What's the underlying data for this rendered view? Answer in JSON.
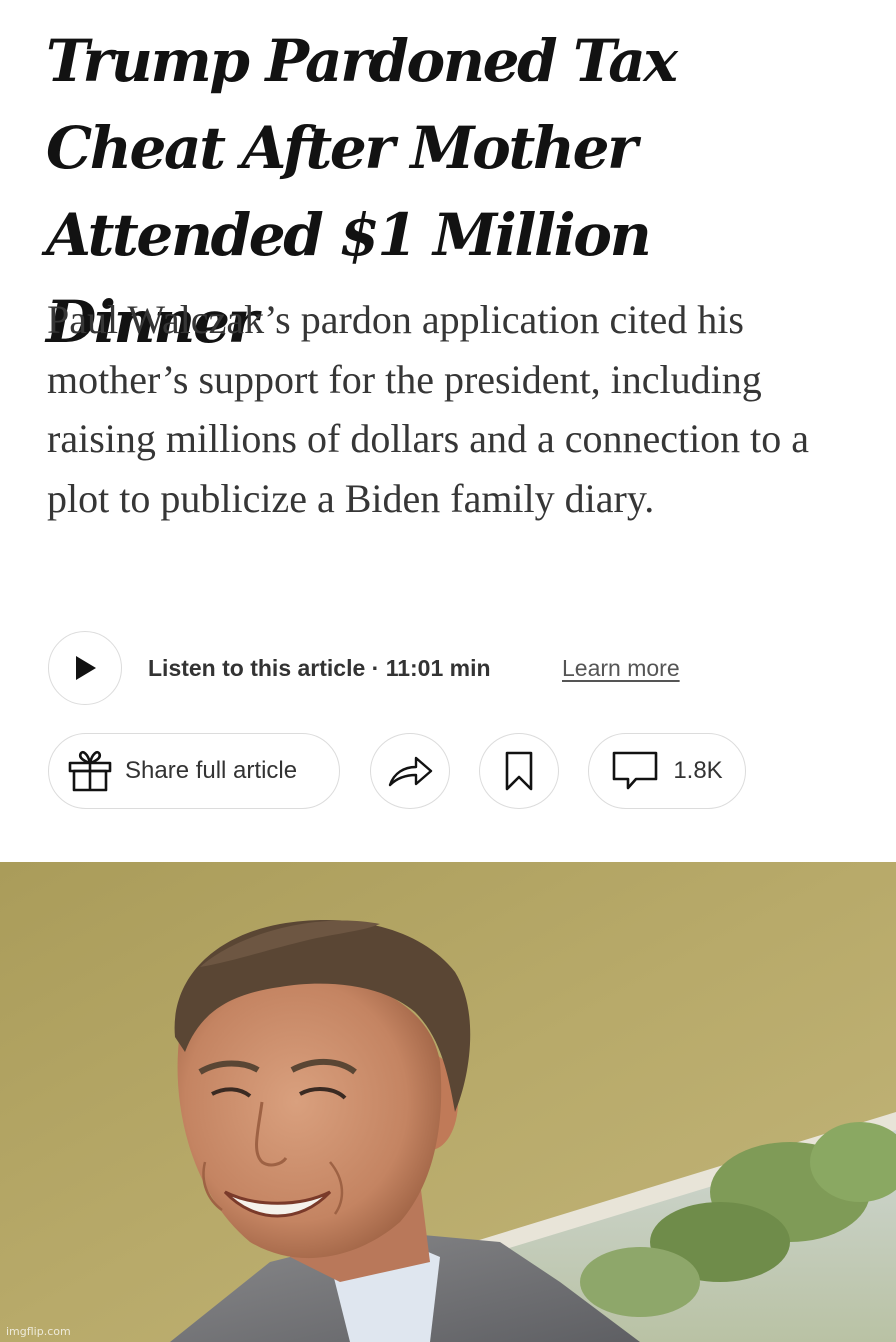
{
  "article": {
    "headline": "Trump Pardoned Tax Cheat After Mother Attended $1 Million Dinner",
    "summary": "Paul Walczak’s pardon application cited his mother’s support for the president, including raising millions of dollars and a connection to a plot to publicize a Biden family diary."
  },
  "audio": {
    "play_icon": "play-icon",
    "listen_label": "Listen to this article · 11:01 min",
    "learn_more": "Learn more"
  },
  "actions": {
    "share_full_label": "Share full article",
    "gift_icon": "gift-icon",
    "share_icon": "share-arrow-icon",
    "bookmark_icon": "bookmark-icon",
    "comment_icon": "comment-icon",
    "comment_count": "1.8K"
  },
  "photo": {
    "watermark": "imgflip.com"
  },
  "colors": {
    "text": "#121212",
    "summary_text": "#363636",
    "border": "#dcdcdc",
    "photo_wall": "#b5a766"
  }
}
